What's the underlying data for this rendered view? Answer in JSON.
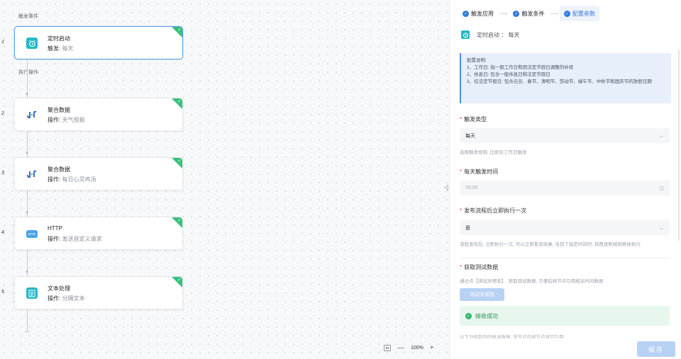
{
  "canvas": {
    "trigger_section": "触发事件",
    "action_section": "执行操作",
    "zoom": "100%",
    "nodes": [
      {
        "num": "1",
        "title": "定时启动",
        "sub_key": "触发:",
        "sub_val": "每天",
        "icon": "alarm-clock-icon",
        "color": "#26b8c6"
      },
      {
        "num": "2",
        "title": "聚合数据",
        "sub_key": "操作:",
        "sub_val": "天气预报",
        "icon": "juhe-logo-icon",
        "color": "#1f5fbf"
      },
      {
        "num": "3",
        "title": "聚合数据",
        "sub_key": "操作:",
        "sub_val": "每日心灵鸡汤",
        "icon": "juhe-logo-icon",
        "color": "#1f5fbf"
      },
      {
        "num": "4",
        "title": "HTTP",
        "sub_key": "操作:",
        "sub_val": "发送自定义请求",
        "icon": "http-icon",
        "color": "#4aa3e8"
      },
      {
        "num": "5",
        "title": "文本处理",
        "sub_key": "操作:",
        "sub_val": "分隔文本",
        "icon": "text-document-icon",
        "color": "#26b8c6"
      }
    ],
    "success_color": "#36c07a"
  },
  "panel": {
    "steps": [
      "触发应用",
      "触发条件",
      "配置参数"
    ],
    "summary": "定时启动 ： 每天",
    "info": {
      "title": "配置说明:",
      "lines": [
        "1、工作日: 指一般工作日和因法定节假日调整的补班",
        "2、休息日: 包含一般休息日和法定节假日",
        "3、仅法定节假日: 包含元旦、春节、清明节、劳动节、端午节、中秋节和国庆节的放假日期"
      ]
    },
    "trigger_type": {
      "label": "触发类型",
      "value": "每天",
      "hint": "选择触发规则, 比如仅工作日触发"
    },
    "daily_time": {
      "label": "每天触发时间",
      "value": "09:00"
    },
    "run_once": {
      "label": "发布流程后立即执行一次",
      "value": "是",
      "hint": "流程发布后, 立即执行一次, 可以立即看到效果, 当到了指定时间时, 将再按照规则继续执行"
    },
    "test_data": {
      "label": "获取测试数据",
      "hint": "通过点【测试并预览】, 获取测试数据, 方便后续节点引用相关时间数据",
      "button": "测试并预览",
      "success": "接收成功",
      "cut_text": "以下为抓取到的样本数据, 该节点后续节点将可引用"
    },
    "save": "保存",
    "accent": "#2f7be0"
  }
}
